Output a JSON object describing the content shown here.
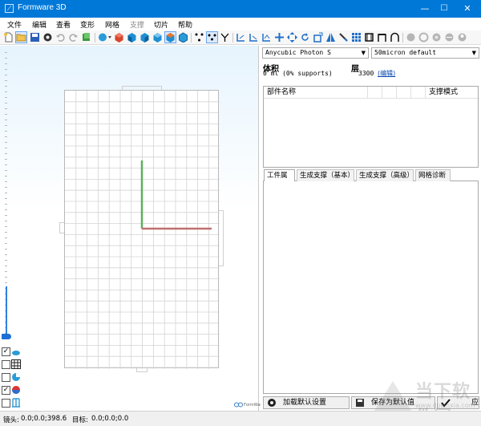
{
  "window": {
    "title": "Formware 3D",
    "minimize": "—",
    "maximize": "☐",
    "close": "✕"
  },
  "menu": [
    "文件",
    "编辑",
    "查看",
    "变形",
    "网格",
    "支撑",
    "切片",
    "帮助"
  ],
  "menu_disabled_index": 5,
  "toolbar_icons": [
    "new-file-icon",
    "open-folder-icon",
    "save-icon",
    "settings-gear-icon",
    "undo-icon",
    "redo-icon",
    "import-icon",
    "sphere-dropdown-icon",
    "view-iso-red-icon",
    "view-front-icon",
    "view-side-icon",
    "view-top-icon",
    "view-active-box-icon",
    "view-box-outline-icon",
    "select-point-icon",
    "select-dots-icon",
    "select-fork-icon",
    "place-support-1-icon",
    "place-support-2-icon",
    "place-support-3-icon",
    "move-icon",
    "move-arrows-icon",
    "rotate-icon",
    "scale-icon",
    "mirror-icon",
    "knife-icon",
    "grid-array-icon",
    "hollow-icon",
    "drain-hole-icon",
    "measure-icon",
    "gray-sphere-1-icon",
    "gray-sphere-2-icon",
    "gray-sphere-3-icon",
    "gray-sphere-4-icon",
    "gray-sphere-5-icon"
  ],
  "right_panel": {
    "printer": "Anycubic Photon S",
    "profile": "50micron default",
    "volume_label": "体积",
    "volume_value": "0 ml (0% supports)",
    "layers_label": "层",
    "layers_value": "3300",
    "edit_link": "(编辑)",
    "parts_columns": [
      "部件名称",
      "",
      "",
      "",
      "",
      "支撑模式"
    ],
    "tabs": [
      "工件属性",
      "生成支撑（基本）",
      "生成支撑（高级）",
      "网格诊断"
    ],
    "buttons": {
      "load_defaults": "加载默认设置",
      "save_as_default": "保存为默认值",
      "apply": "应"
    }
  },
  "status": {
    "camera_label": "镜头:",
    "camera_value": "0.0;0.0;398.6",
    "target_label": "目标:",
    "target_value": "0.0;0.0;0.0"
  },
  "watermark": {
    "text": "当下软件园",
    "url": "www.downxia.com"
  },
  "plate_logo": "FormWare",
  "colors": {
    "titlebar": "#0078d7",
    "axis_y": "#5faf5f",
    "axis_x": "#c07070",
    "accent": "#2f7fde"
  }
}
